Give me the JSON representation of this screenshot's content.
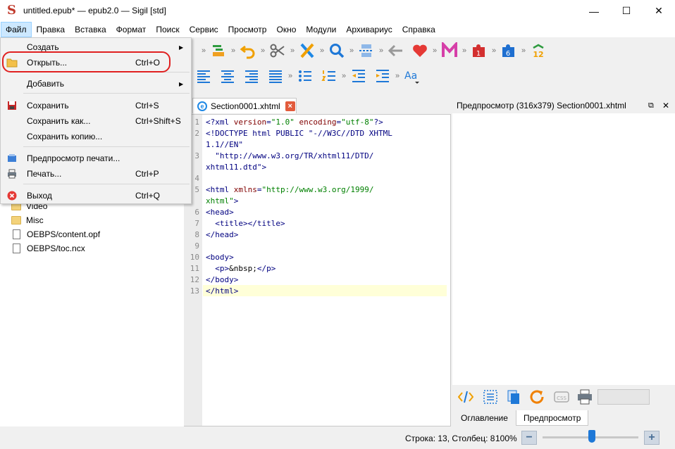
{
  "window": {
    "title": "untitled.epub* — epub2.0 — Sigil [std]",
    "logo_letter": "S",
    "minimize": "—",
    "maximize": "☐",
    "close": "✕"
  },
  "menubar": {
    "items": [
      "Файл",
      "Правка",
      "Вставка",
      "Формат",
      "Поиск",
      "Сервис",
      "Просмотр",
      "Окно",
      "Модули",
      "Архивариус",
      "Справка"
    ],
    "active": "Файл"
  },
  "file_menu": {
    "items": [
      {
        "label": "Создать",
        "shortcut": "",
        "submenu": true
      },
      {
        "label": "Открыть...",
        "shortcut": "Ctrl+O",
        "icon": "folder-open-icon"
      },
      {
        "label": "Добавить",
        "shortcut": "",
        "submenu": true
      },
      {
        "label": "Сохранить",
        "shortcut": "Ctrl+S",
        "icon": "save-icon"
      },
      {
        "label": "Сохранить как...",
        "shortcut": "Ctrl+Shift+S"
      },
      {
        "label": "Сохранить копию...",
        "shortcut": ""
      },
      {
        "label": "Предпросмотр печати...",
        "shortcut": "",
        "icon": "print-preview-icon"
      },
      {
        "label": "Печать...",
        "shortcut": "Ctrl+P",
        "icon": "printer-icon"
      },
      {
        "label": "Выход",
        "shortcut": "Ctrl+Q",
        "icon": "exit-icon"
      }
    ],
    "highlighted": "Открыть..."
  },
  "toolbar": {
    "row1_icons": [
      "insert-icon",
      "undo-icon",
      "cut-icon",
      "cleanup-icon",
      "search-icon",
      "split-icon",
      "back-icon",
      "heart-icon",
      "m-icon",
      "plugin1-icon",
      "plugin6-icon",
      "numbers-icon"
    ],
    "plugin_badges": [
      "1",
      "6",
      "12"
    ],
    "row2_icons": [
      "align-left-icon",
      "align-center-icon",
      "align-right-icon",
      "align-justify-icon",
      "bullet-list-icon",
      "numbered-list-icon",
      "outdent-icon",
      "indent-icon",
      "text-case-icon"
    ],
    "text_case_label": "Aa"
  },
  "book_browser": {
    "items": [
      {
        "name": "Video",
        "type": "folder"
      },
      {
        "name": "Misc",
        "type": "folder"
      },
      {
        "name": "OEBPS/content.opf",
        "type": "file"
      },
      {
        "name": "OEBPS/toc.ncx",
        "type": "file"
      }
    ]
  },
  "editor": {
    "tab_label": "Section0001.xhtml",
    "tab_icon_letter": "e",
    "line_numbers": [
      "1",
      "2",
      "3",
      "4",
      "5",
      "6",
      "7",
      "8",
      "9",
      "10",
      "11",
      "12",
      "13"
    ]
  },
  "preview": {
    "header": "Предпросмотр (316x379) Section0001.xhtml",
    "tabs": [
      "Оглавление",
      "Предпросмотр"
    ],
    "active_tab": "Предпросмотр"
  },
  "statusbar": {
    "position": "Строка: 13, Столбец: 8",
    "zoom": "100%",
    "zoom_out": "−",
    "zoom_in": "+"
  },
  "colors": {
    "accent": "#1e78d7",
    "highlight_ring": "#e02020",
    "menu_active": "#cce8ff"
  }
}
